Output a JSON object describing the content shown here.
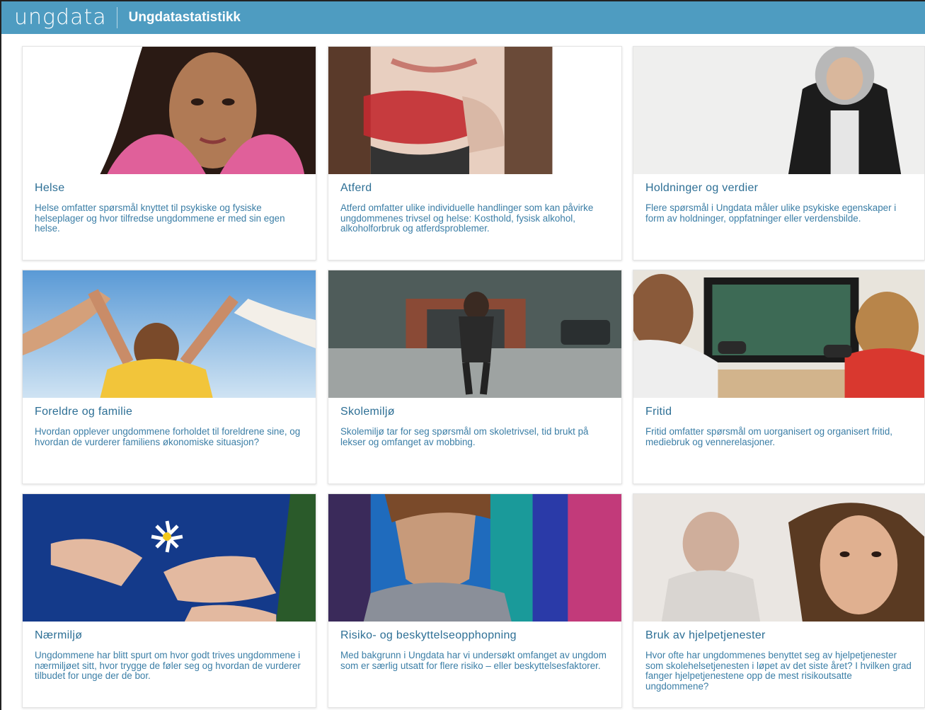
{
  "header": {
    "logo_text": "ungdata",
    "title": "Ungdatastatistikk",
    "background_color": "#4e9cc1"
  },
  "cards": [
    {
      "title": "Helse",
      "text": "Helse omfatter spørsmål knyttet til psykiske og fysiske helseplager og hvor tilfredse ungdommene er med sin egen helse."
    },
    {
      "title": "Atferd",
      "text": "Atferd omfatter ulike individuelle handlinger som kan påvirke ungdommenes trivsel og helse: Kosthold, fysisk alkohol, alkoholforbruk og atferdsproblemer."
    },
    {
      "title": "Holdninger og verdier",
      "text": "Flere spørsmål i Ungdata måler ulike psykiske egenskaper i form av holdninger, oppfatninger eller verdensbilde."
    },
    {
      "title": "Foreldre og familie",
      "text": "Hvordan opplever ungdommene forholdet til foreldrene sine, og hvordan de vurderer familiens økonomiske situasjon?"
    },
    {
      "title": "Skolemiljø",
      "text": "Skolemiljø tar for seg spørsmål om skoletrivsel, tid brukt på lekser og omfanget av mobbing."
    },
    {
      "title": "Fritid",
      "text": "Fritid omfatter spørsmål om uorganisert og organisert fritid, mediebruk og vennerelasjoner."
    },
    {
      "title": "Nærmiljø",
      "text": "Ungdommene har blitt spurt om hvor godt trives ungdommene i nærmiljøet sitt, hvor trygge de føler seg og hvordan de vurderer tilbudet for unge der de bor."
    },
    {
      "title": "Risiko- og beskyttelseopphopning",
      "text": "Med bakgrunn i Ungdata har vi undersøkt omfanget av ungdom som er særlig utsatt for flere risiko – eller beskyttelsesfaktorer."
    },
    {
      "title": "Bruk av hjelpetjenester",
      "text": "Hvor ofte har ungdommenes benyttet seg av hjelpetjenester som skolehelsetjenesten i løpet av det siste året? I hvilken grad fanger hjelpetjenestene opp de mest risikoutsatte ungdommene?"
    }
  ]
}
